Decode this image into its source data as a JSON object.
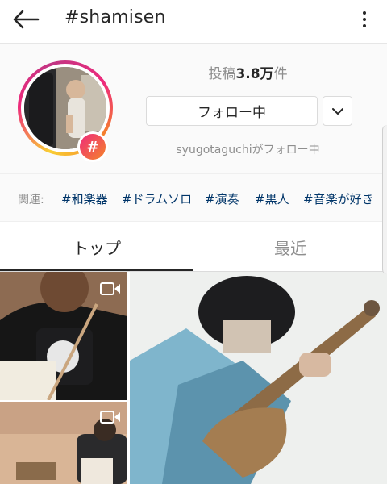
{
  "header": {
    "title": "#shamisen"
  },
  "profile": {
    "post_count_prefix": "投稿",
    "post_count_value": "3.8万",
    "post_count_suffix": "件",
    "follow_button_label": "フォロー中",
    "followed_by_text": "syugotaguchiがフォロー中",
    "badge_symbol": "#"
  },
  "related": {
    "label": "関連:",
    "tags": [
      "#和楽器",
      "#ドラムソロ",
      "#演奏",
      "#黒人",
      "#音楽が好き"
    ]
  },
  "tabs": {
    "top_label": "トップ",
    "recent_label": "最近"
  },
  "colors": {
    "text": "#262626",
    "muted": "#8e8e8e",
    "tag_link": "#003569",
    "badge_gradient_start": "#ee2a7b",
    "badge_gradient_end": "#f58529"
  },
  "icons": {
    "back": "arrow-left-icon",
    "menu": "kebab-menu-icon",
    "dropdown": "chevron-down-icon",
    "video": "video-camera-icon"
  }
}
